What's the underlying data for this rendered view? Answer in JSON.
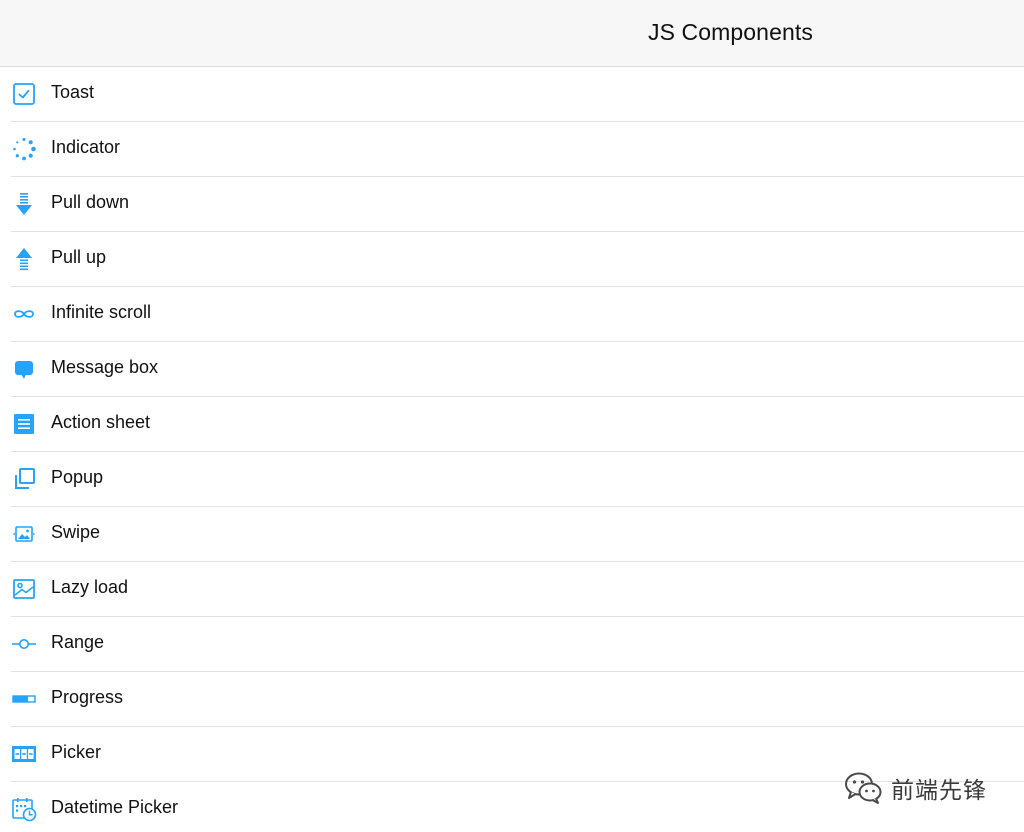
{
  "header": {
    "title": "JS Components"
  },
  "accent_color": "#26a2ff",
  "items": [
    {
      "label": "Toast",
      "icon": "toast-icon"
    },
    {
      "label": "Indicator",
      "icon": "indicator-icon"
    },
    {
      "label": "Pull down",
      "icon": "pull-down-icon"
    },
    {
      "label": "Pull up",
      "icon": "pull-up-icon"
    },
    {
      "label": "Infinite scroll",
      "icon": "infinite-scroll-icon"
    },
    {
      "label": "Message box",
      "icon": "message-box-icon"
    },
    {
      "label": "Action sheet",
      "icon": "action-sheet-icon"
    },
    {
      "label": "Popup",
      "icon": "popup-icon"
    },
    {
      "label": "Swipe",
      "icon": "swipe-icon"
    },
    {
      "label": "Lazy load",
      "icon": "lazy-load-icon"
    },
    {
      "label": "Range",
      "icon": "range-icon"
    },
    {
      "label": "Progress",
      "icon": "progress-icon"
    },
    {
      "label": "Picker",
      "icon": "picker-icon"
    },
    {
      "label": "Datetime Picker",
      "icon": "datetime-picker-icon"
    }
  ],
  "watermark": {
    "text": "前端先锋",
    "icon": "wechat-logo-icon"
  }
}
